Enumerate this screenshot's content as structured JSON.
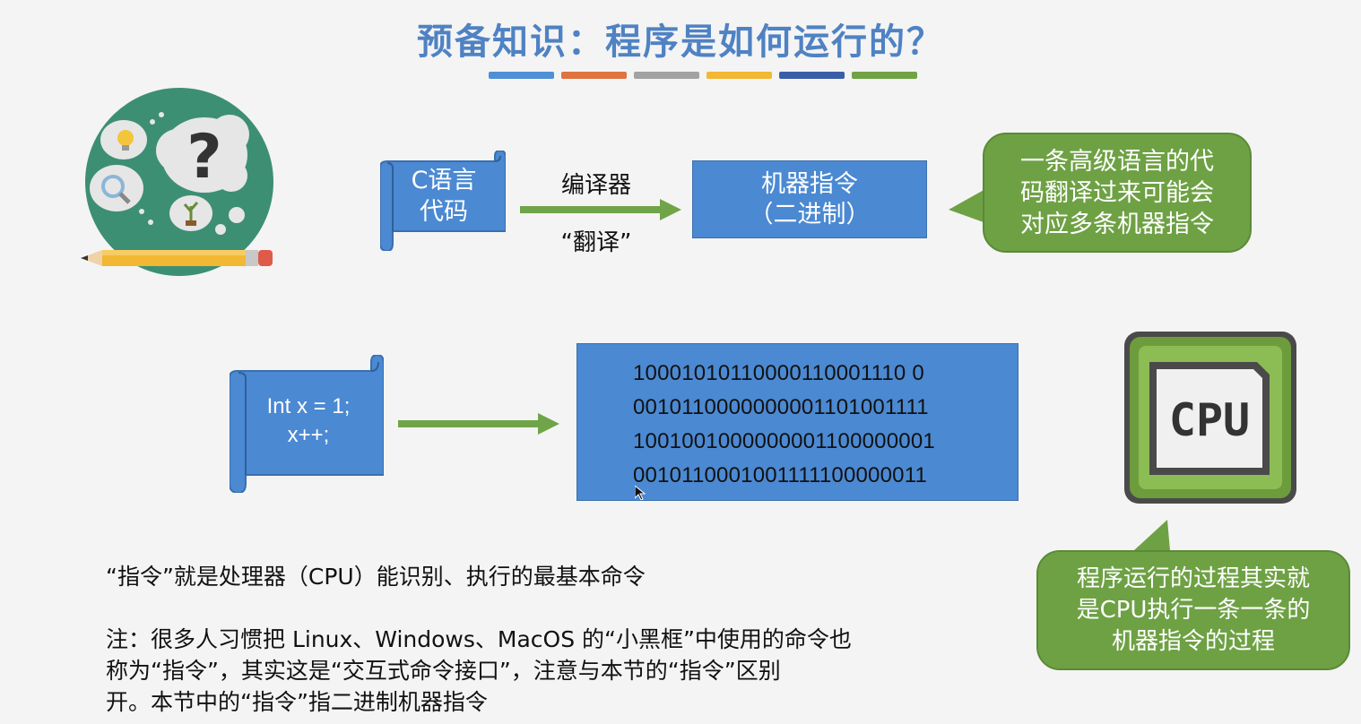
{
  "title": "预备知识：程序是如何运行的？",
  "stripe_colors": [
    "#4f8fd6",
    "#e0733f",
    "#a2a2a2",
    "#f2b733",
    "#3b5ea8",
    "#6fa343"
  ],
  "top_row": {
    "source_scroll": {
      "line1": "C语言",
      "line2": "代码"
    },
    "arrow_label_top": "编译器",
    "arrow_label_bottom": "“翻译”",
    "machine_box": {
      "line1": "机器指令",
      "line2": "（二进制）"
    },
    "bubble": {
      "line1": "一条高级语言的代",
      "line2": "码翻译过来可能会",
      "line3": "对应多条机器指令"
    }
  },
  "middle_row": {
    "code_scroll": {
      "line1": "Int x = 1;",
      "line2": "x++;"
    },
    "binary": [
      "10001010110000110001110 0",
      "0010110000000001101001111",
      "1001001000000001100000001",
      "0010110001001111100000011"
    ],
    "cpu_label": "CPU",
    "cpu_bubble": {
      "line1": "程序运行的过程其实就",
      "line2": "是CPU执行一条一条的",
      "line3": "机器指令的过程"
    }
  },
  "definition": "“指令”就是处理器（CPU）能识别、执行的最基本命令",
  "note": {
    "line1": "注：很多人习惯把 Linux、Windows、MacOS 的“小黑框”中使用的命令也",
    "line2": "称为“指令”，其实这是“交互式命令接口”，注意与本节的“指令”区别",
    "line3": "开。本节中的“指令”指二进制机器指令"
  },
  "colors": {
    "title": "#4f82c3",
    "blue_box": "#4b89d2",
    "green_bubble": "#6ea144",
    "arrow_green": "#70a448",
    "illustration_circle": "#3d8f74",
    "cpu_outer": "#6d9c3c",
    "cpu_inner": "#8cbd55"
  },
  "icons": {
    "illustration": "thinking-clouds-pencil",
    "cpu": "cpu-chip-icon"
  }
}
